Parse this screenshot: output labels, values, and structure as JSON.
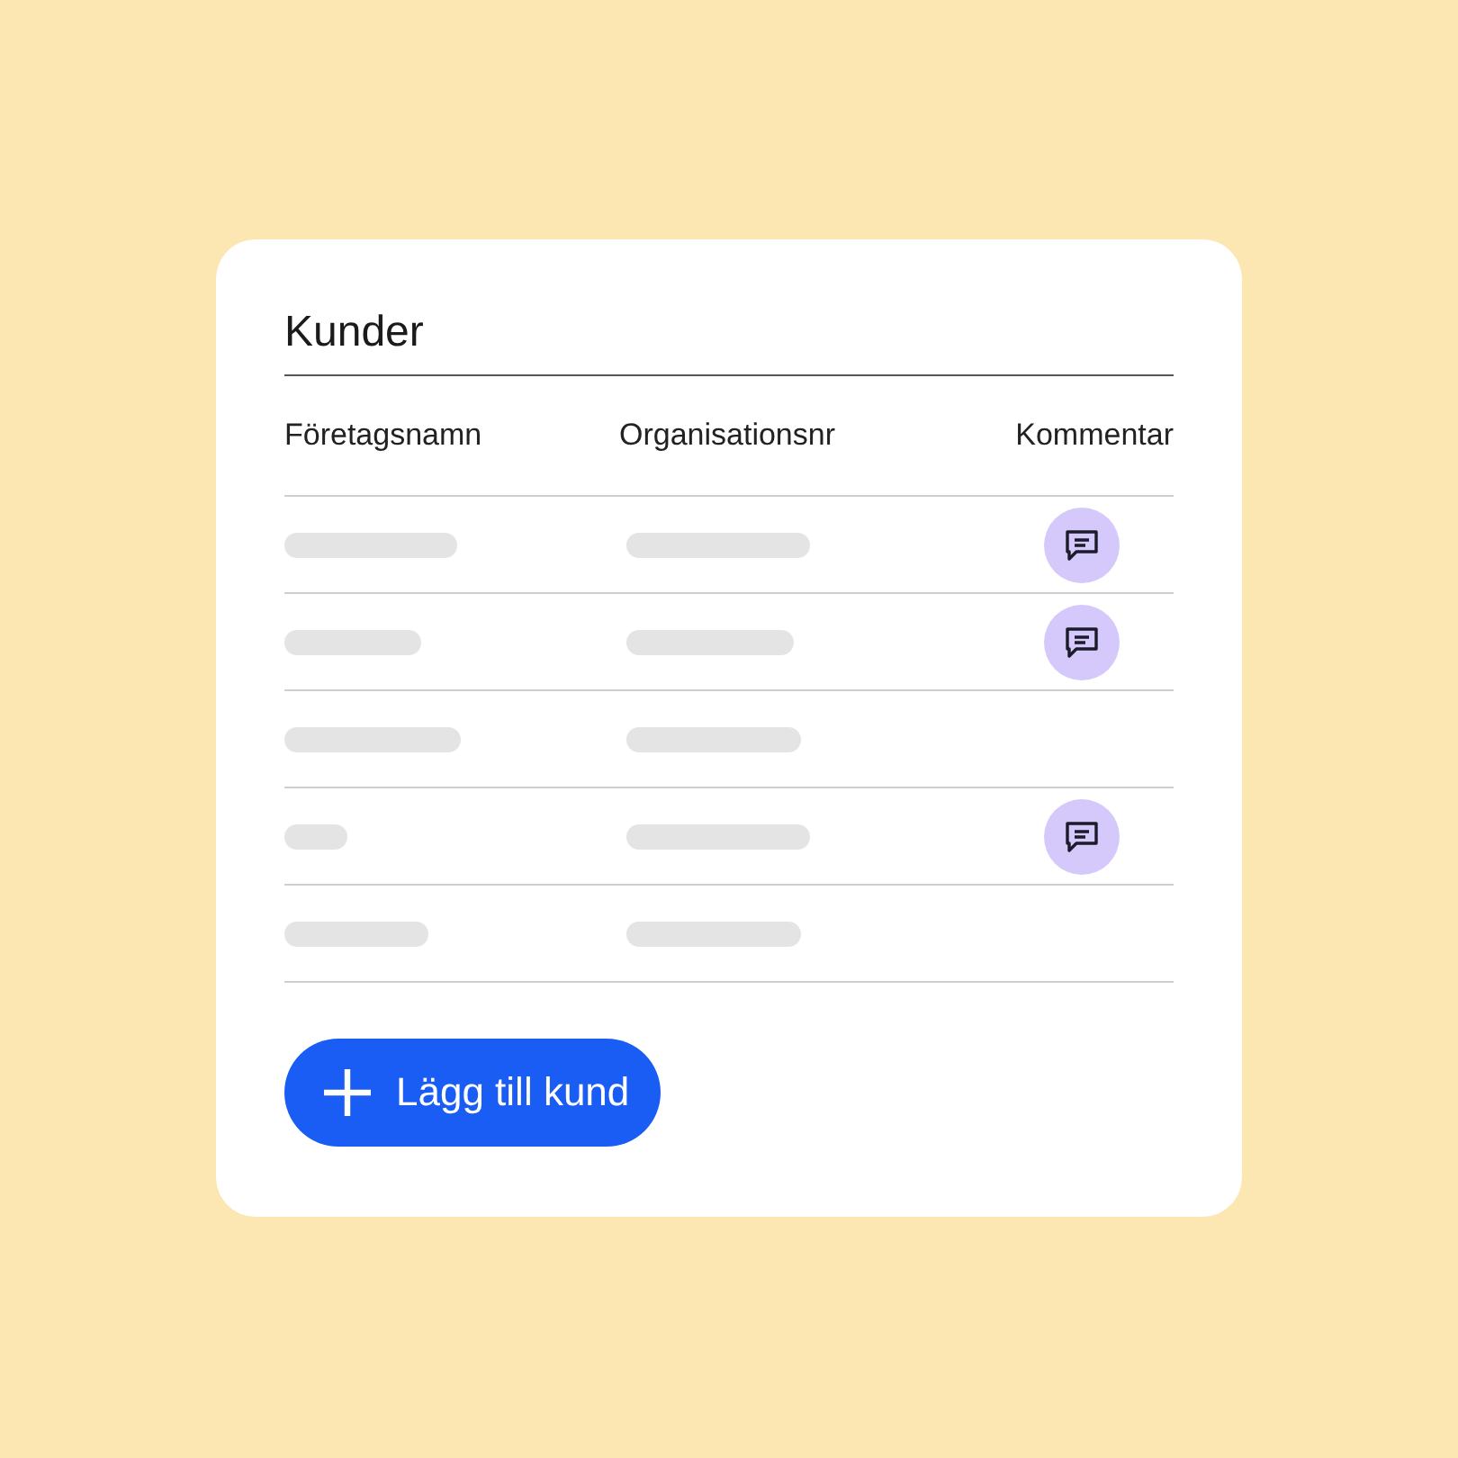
{
  "card": {
    "title": "Kunder"
  },
  "table": {
    "columns": [
      "Företagsnamn",
      "Organisationsnr",
      "Kommentar"
    ],
    "rows": [
      {
        "kind": "skeleton",
        "comment": true
      },
      {
        "kind": "skeleton",
        "comment": true
      },
      {
        "kind": "skeleton",
        "comment": false
      },
      {
        "kind": "skeleton",
        "comment": true
      },
      {
        "kind": "skeleton",
        "comment": false
      }
    ]
  },
  "button": {
    "label": "Lägg till kund"
  }
}
